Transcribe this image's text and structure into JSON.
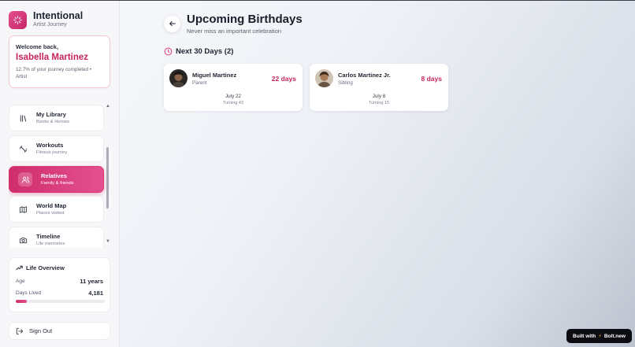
{
  "colors": {
    "accent": "#c8245f",
    "accent_light": "#e4508f"
  },
  "brand": {
    "title": "Intentional",
    "subtitle": "Artist Journey",
    "icon": "sparkle-icon"
  },
  "welcome": {
    "label": "Welcome back,",
    "name": "Isabella Martinez",
    "progress_text": "12.7% of your journey completed • Artist"
  },
  "nav": {
    "items": [
      {
        "title": "My Library",
        "subtitle": "Books & Heroes",
        "icon": "library-icon"
      },
      {
        "title": "Workouts",
        "subtitle": "Fitness journey",
        "icon": "dumbbell-icon"
      },
      {
        "title": "Relatives",
        "subtitle": "Family & friends",
        "icon": "users-icon",
        "active": true
      },
      {
        "title": "World Map",
        "subtitle": "Places visited",
        "icon": "map-icon"
      },
      {
        "title": "Timeline",
        "subtitle": "Life memories",
        "icon": "camera-icon"
      }
    ],
    "scroll_up": "▲",
    "scroll_down": "▼"
  },
  "overview": {
    "title": "Life Overview",
    "icon": "trending-up-icon",
    "age_label": "Age",
    "age_value": "11 years",
    "days_label": "Days Lived",
    "days_value": "4,181",
    "progress_fraction": 0.127
  },
  "signout": {
    "label": "Sign Out",
    "icon": "logout-icon"
  },
  "main": {
    "back_icon": "arrow-left-icon",
    "title": "Upcoming Birthdays",
    "subtitle": "Never miss an important celebration",
    "section_title": "Next 30 Days (2)",
    "section_icon": "clock-icon",
    "birthdays": [
      {
        "name": "Miguel Martinez",
        "relation": "Parent",
        "days": "22 days",
        "date": "July 22",
        "turning": "Turning 43"
      },
      {
        "name": "Carlos Martinez Jr.",
        "relation": "Sibling",
        "days": "8 days",
        "date": "July 8",
        "turning": "Turning 15"
      }
    ]
  },
  "badge": {
    "prefix": "Built with",
    "icon": "lightning-icon",
    "name": "Bolt.new"
  }
}
